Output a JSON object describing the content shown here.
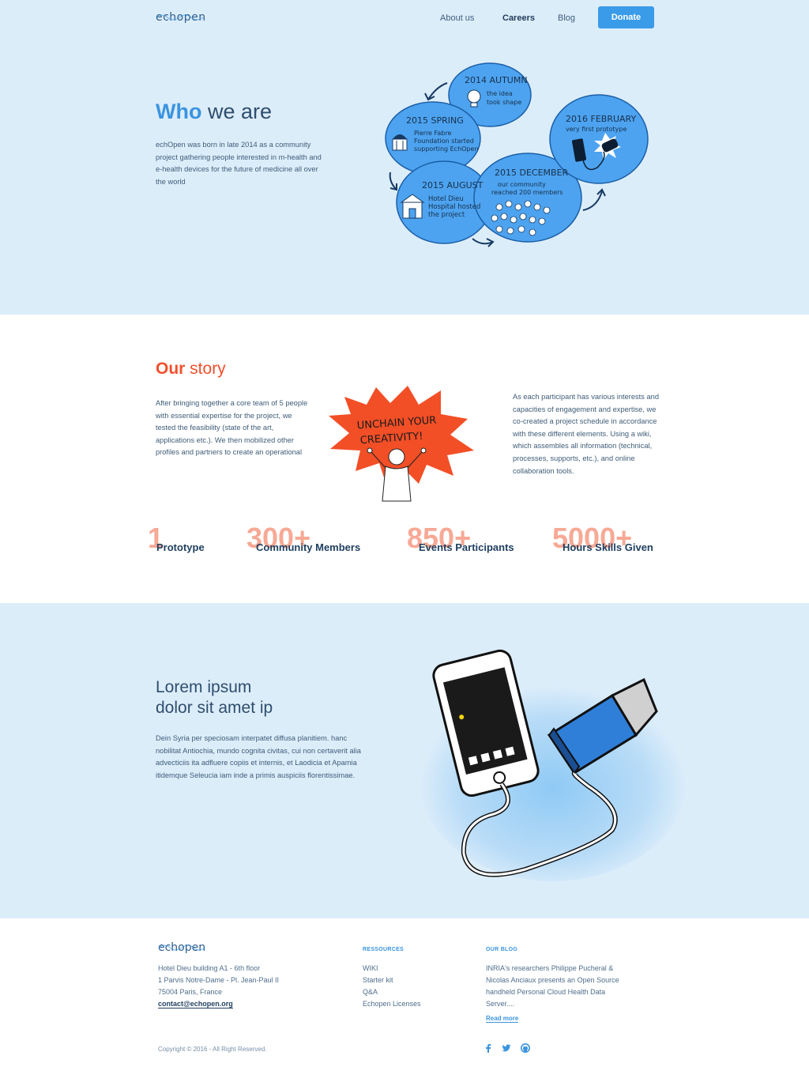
{
  "header": {
    "logo_text": "echopen",
    "nav": [
      "About us",
      "Careers",
      "Blog"
    ],
    "active_nav": "Careers",
    "donate_label": "Donate"
  },
  "who": {
    "title_accent": "Who",
    "title_rest": " we are",
    "text": "echOpen was born in late 2014 as a community project gathering people interested in m-health and e-health devices for the future of medicine all over the world"
  },
  "timeline": {
    "autumn": {
      "date": "2014 AUTUMN",
      "l1": "the idea",
      "l2": "took shape"
    },
    "spring": {
      "date": "2015 SPRING",
      "l1": "Pierre Fabre",
      "l2": "Foundation started",
      "l3": "supporting EchOpen"
    },
    "august": {
      "date": "2015 AUGUST",
      "l1": "Hotel Dieu",
      "l2": "Hospital hosted",
      "l3": "the project"
    },
    "december": {
      "date": "2015 DECEMBER",
      "l1": "our community",
      "l2": "reached 200 members"
    },
    "february": {
      "date": "2016 FEBRUARY",
      "l1": "very first prototype"
    }
  },
  "story": {
    "title_bold": "Our",
    "title_rest": " story",
    "left_text": "After bringing together a core team of 5 people with essential expertise for the project, we tested the feasibility (state of the art, applications etc.). We then mobilized other profiles and partners to create an operational",
    "right_text": "As each participant has various interests and capacities of engagement and expertise, we co-created a project schedule in accordance with these different elements. Using a wiki, which assembles all information (technical, processes, supports, etc.), and online collaboration tools.",
    "burst_l1": "UNCHAIN YOUR",
    "burst_l2": "CREATIVITY!"
  },
  "stats": [
    {
      "num": "1",
      "label": "Prototype"
    },
    {
      "num": "300+",
      "label": "Community Members"
    },
    {
      "num": "850+",
      "label": "Events Participants"
    },
    {
      "num": "5000+",
      "label": "Hours Skills Given"
    }
  ],
  "lorem": {
    "title_l1": "Lorem ipsum",
    "title_l2": "dolor sit amet ip",
    "text": "Dein Syria per speciosam interpatet diffusa planitiem. hanc nobilitat Antiochia, mundo cognita civitas, cui non certaverit alia advecticiis ita adfluere copiis et internis, et Laodicia et Apamia itidemque Seleucia iam inde a primis auspiciis florentissimae."
  },
  "footer": {
    "logo_text": "echopen",
    "address": [
      "Hotel Dieu building A1 - 6th floor",
      "1 Parvis Notre-Dame - Pl. Jean-Paul II",
      "75004 Paris, France"
    ],
    "email": "contact@echopen.org",
    "resources_head": "RESSOURCES",
    "resources": [
      "WIKI",
      "Starter kit",
      "Q&A",
      "Echopen Licenses"
    ],
    "blog_head": "OUR BLOG",
    "blog_lines": [
      "INRIA's researchers Philippe Pucheral &",
      "Nicolas Anciaux presents an Open Source",
      "handheld Personal Cloud Health Data",
      "Server...."
    ],
    "read_more": "Read more",
    "copyright": "Copyright © 2016 - All Right Reserved."
  },
  "social_icons": [
    "facebook-icon",
    "twitter-icon",
    "github-icon"
  ],
  "colors": {
    "accent_blue": "#3a94e0",
    "story_red": "#f0502d",
    "stat_salmon": "#f7a995",
    "hero_bg": "#dcedfa",
    "bubble": "#4da3ef"
  }
}
